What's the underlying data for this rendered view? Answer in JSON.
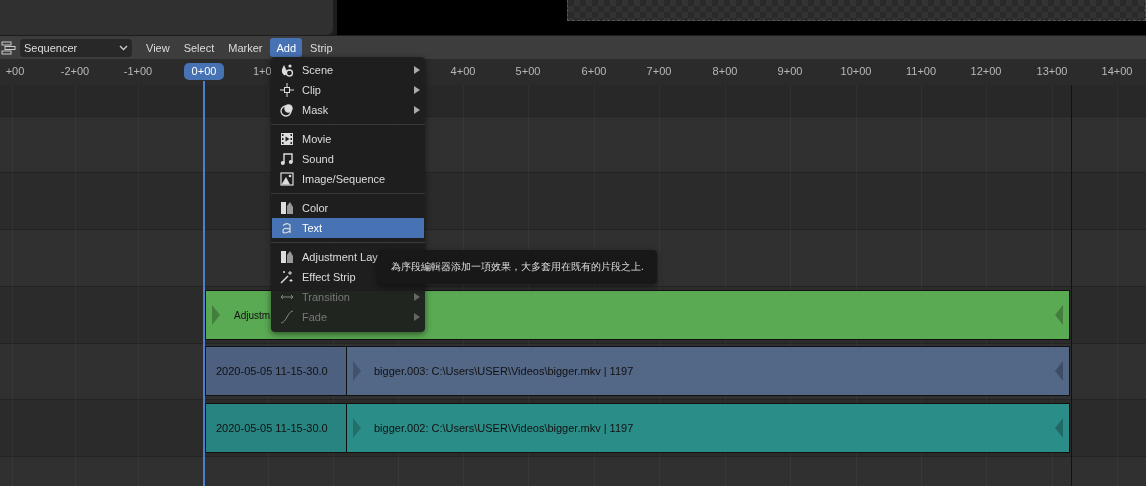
{
  "header": {
    "editor_type": "Sequencer",
    "menus": [
      {
        "label": "View",
        "selected": false
      },
      {
        "label": "Select",
        "selected": false
      },
      {
        "label": "Marker",
        "selected": false
      },
      {
        "label": "Add",
        "selected": true
      },
      {
        "label": "Strip",
        "selected": false
      }
    ]
  },
  "ruler": {
    "ticks": [
      "+00",
      "-2+00",
      "-1+00",
      "1+0",
      "4+00",
      "5+00",
      "6+00",
      "7+00",
      "8+00",
      "9+00",
      "10+00",
      "11+00",
      "12+00",
      "13+00",
      "14+00"
    ],
    "playhead": "0+00"
  },
  "strips": [
    {
      "color": "#5aa953",
      "label": "Adjustm"
    },
    {
      "color": "#536787",
      "prefix": "2020-05-05 11-15-30.0",
      "label": "bigger.003: C:\\Users\\USER\\Videos\\bigger.mkv | 1197"
    },
    {
      "color": "#2b8d88",
      "prefix": "2020-05-05 11-15-30.0",
      "label": "bigger.002: C:\\Users\\USER\\Videos\\bigger.mkv | 1197"
    }
  ],
  "add_menu": {
    "groups": [
      [
        {
          "label": "Scene",
          "submenu": true,
          "disabled": false,
          "selected": false
        },
        {
          "label": "Clip",
          "submenu": true,
          "disabled": false,
          "selected": false
        },
        {
          "label": "Mask",
          "submenu": true,
          "disabled": false,
          "selected": false
        }
      ],
      [
        {
          "label": "Movie",
          "submenu": false,
          "disabled": false,
          "selected": false
        },
        {
          "label": "Sound",
          "submenu": false,
          "disabled": false,
          "selected": false
        },
        {
          "label": "Image/Sequence",
          "submenu": false,
          "disabled": false,
          "selected": false
        }
      ],
      [
        {
          "label": "Color",
          "submenu": false,
          "disabled": false,
          "selected": false
        },
        {
          "label": "Text",
          "submenu": false,
          "disabled": false,
          "selected": true
        }
      ],
      [
        {
          "label": "Adjustment Lay",
          "submenu": false,
          "disabled": false,
          "selected": false
        },
        {
          "label": "Effect Strip",
          "submenu": false,
          "disabled": false,
          "selected": false
        },
        {
          "label": "Transition",
          "submenu": true,
          "disabled": true,
          "selected": false
        },
        {
          "label": "Fade",
          "submenu": true,
          "disabled": true,
          "selected": false
        }
      ]
    ]
  },
  "tooltip": "為序段編輯器添加一項效果，大多套用在既有的片段之上."
}
